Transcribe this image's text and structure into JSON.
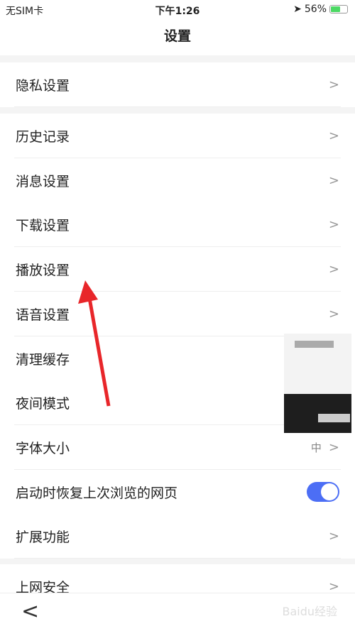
{
  "status": {
    "carrier": "无SIM卡",
    "time": "下午1:26",
    "battery": "56%",
    "battery_level": 0.56,
    "battery_color": "#4cd964"
  },
  "header": {
    "title": "设置"
  },
  "group1": [
    {
      "label": "隐私设置"
    }
  ],
  "group2": [
    {
      "label": "历史记录"
    },
    {
      "label": "消息设置"
    },
    {
      "label": "下载设置"
    },
    {
      "label": "播放设置"
    },
    {
      "label": "语音设置"
    },
    {
      "label": "清理缓存"
    },
    {
      "label": "夜间模式"
    },
    {
      "label": "字体大小",
      "value": "中"
    },
    {
      "label": "启动时恢复上次浏览的网页",
      "toggle": true
    },
    {
      "label": "扩展功能"
    }
  ],
  "group3": [
    {
      "label": "上网安全"
    }
  ],
  "accent": "#4c6ef5",
  "watermark": "Baidu经验"
}
